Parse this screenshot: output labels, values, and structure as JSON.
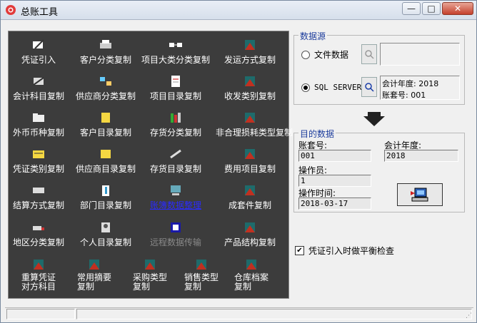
{
  "window": {
    "title": "总账工具"
  },
  "tools": [
    {
      "label": "凭证引入"
    },
    {
      "label": "客户分类复制"
    },
    {
      "label": "项目大类分类复制"
    },
    {
      "label": "发运方式复制"
    },
    {
      "label": "会计科目复制"
    },
    {
      "label": "供应商分类复制"
    },
    {
      "label": "项目目录复制"
    },
    {
      "label": "收发类别复制"
    },
    {
      "label": "外币币种复制"
    },
    {
      "label": "客户目录复制"
    },
    {
      "label": "存货分类复制"
    },
    {
      "label": "非合理损耗类型复制"
    },
    {
      "label": "凭证类别复制"
    },
    {
      "label": "供应商目录复制"
    },
    {
      "label": "存货目录复制"
    },
    {
      "label": "费用项目复制"
    },
    {
      "label": "结算方式复制"
    },
    {
      "label": "部门目录复制"
    },
    {
      "label": "账簿数据整理"
    },
    {
      "label": "成套件复制"
    },
    {
      "label": "地区分类复制"
    },
    {
      "label": "个人目录复制"
    },
    {
      "label": "远程数据传输"
    },
    {
      "label": "产品结构复制"
    },
    {
      "label": "重算凭证\n对方科目"
    },
    {
      "label": "常用摘要\n复制"
    },
    {
      "label": "采购类型\n复制"
    },
    {
      "label": "销售类型\n复制"
    },
    {
      "label": "仓库档案\n复制"
    }
  ],
  "source": {
    "legend": "数据源",
    "file_option": "文件数据",
    "sql_option": "SQL SERVER",
    "sql_selected": true,
    "file_path": "",
    "info_year": "会计年度: 2018",
    "info_account": "账套号: 001"
  },
  "target": {
    "legend": "目的数据",
    "account_label": "账套号:",
    "account_value": "001",
    "year_label": "会计年度:",
    "year_value": "2018",
    "operator_label": "操作员:",
    "operator_value": "1",
    "time_label": "操作时间:",
    "time_value": "2018-03-17"
  },
  "balance_check": {
    "label": "凭证引入时做平衡检查",
    "checked": true
  },
  "colors": {
    "panel": "#3c3c3c",
    "legend": "#1c3c9c",
    "link": "#2b2bff"
  }
}
